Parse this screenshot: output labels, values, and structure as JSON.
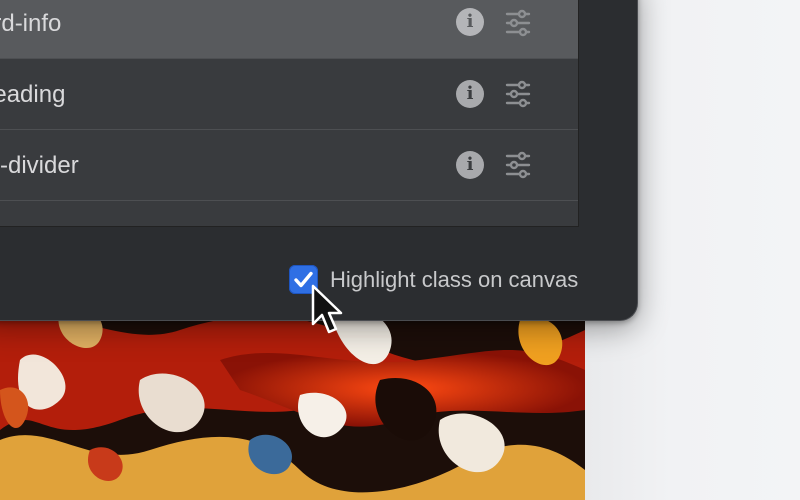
{
  "classes_list": {
    "rows": [
      {
        "label": "ard-info",
        "selected": true
      },
      {
        "label": "heading",
        "selected": false
      },
      {
        "label": "ry-divider",
        "selected": false
      }
    ],
    "info_icon_glyph": "i"
  },
  "footer": {
    "highlight_checkbox_label": "Highlight class on canvas",
    "highlight_checked": true
  },
  "colors": {
    "dialog_bg": "#2b2d30",
    "list_bg": "#393b3e",
    "selected_row": "#585a5d",
    "checkbox_accent": "#2f6fe4"
  }
}
